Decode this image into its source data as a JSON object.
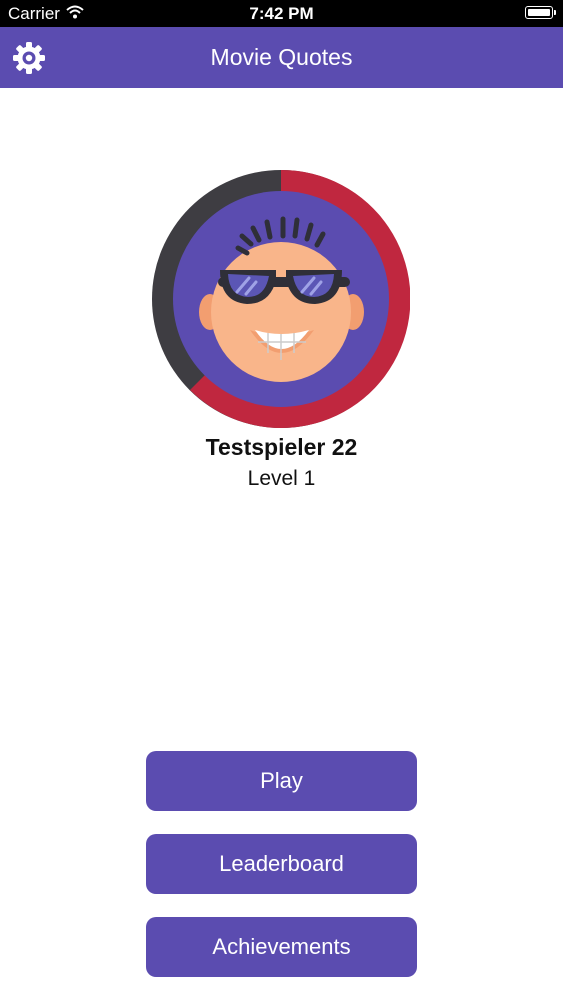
{
  "status_bar": {
    "carrier": "Carrier",
    "time": "7:42 PM",
    "battery_level": 1.0
  },
  "nav": {
    "title": "Movie Quotes",
    "settings_icon": "gear-icon"
  },
  "profile": {
    "avatar_icon": "cool-face-sunglasses-avatar",
    "name": "Testspieler 22",
    "level": "Level 1"
  },
  "menu": {
    "play_label": "Play",
    "leaderboard_label": "Leaderboard",
    "achievements_label": "Achievements"
  },
  "colors": {
    "accent": "#5b4cb0",
    "progress_ring": "#c0273f",
    "ring_track": "#3e3d42",
    "skin": "#f9b58a"
  }
}
